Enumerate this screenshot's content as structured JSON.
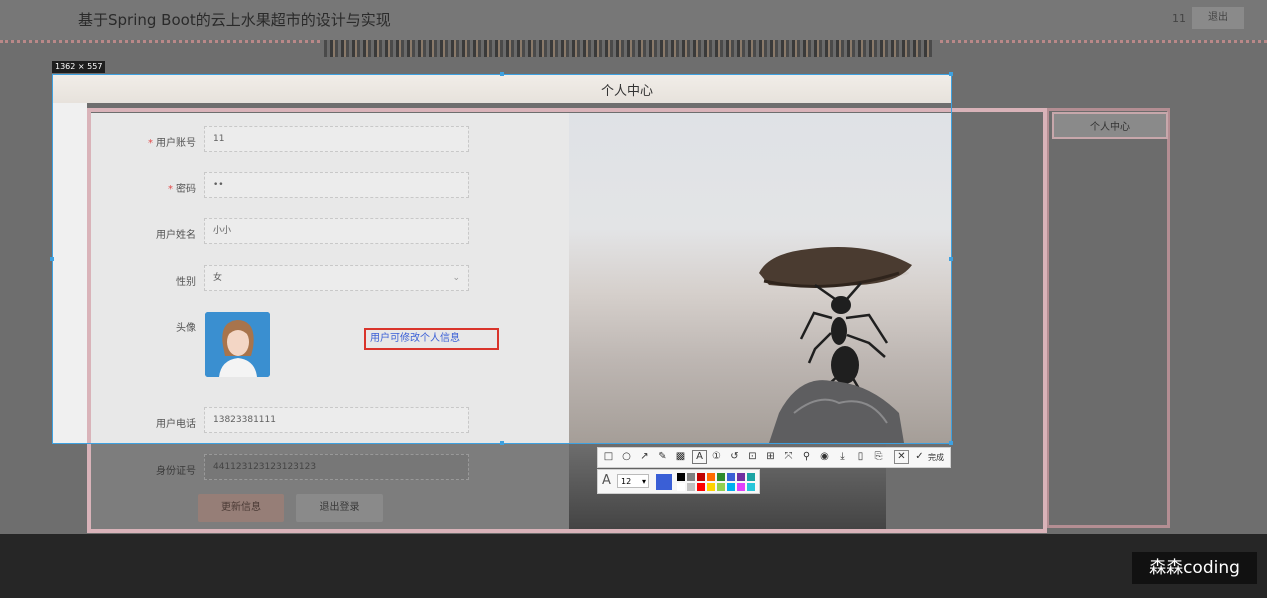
{
  "header": {
    "site_title": "基于Spring Boot的云上水果超市的设计与实现",
    "user": "11",
    "logout_label": "退出"
  },
  "screenshot_tool": {
    "size_label": "1362 × 557",
    "done_label": "完成",
    "font_size_value": "12"
  },
  "page": {
    "title": "个人中心"
  },
  "sidebar": {
    "items": [
      {
        "label": "个人中心"
      }
    ]
  },
  "form": {
    "account": {
      "label": "用户账号",
      "value": "11",
      "required": "*"
    },
    "password": {
      "label": "密码",
      "value": "••",
      "required": "*"
    },
    "name": {
      "label": "用户姓名",
      "value": "小小"
    },
    "gender": {
      "label": "性别",
      "value": "女"
    },
    "avatar": {
      "label": "头像"
    },
    "phone": {
      "label": "用户电话",
      "value": "13823381111"
    },
    "id_card": {
      "label": "身份证号",
      "value": "441123123123123123"
    },
    "update_button": "更新信息",
    "logout_button": "退出登录"
  },
  "annotation_note": "用户可修改个人信息",
  "watermark": "森森coding",
  "colors": {
    "selection": "#3ea1e0",
    "note_border": "#d9342b",
    "note_text": "#3a5fd6",
    "required": "#e24a4a"
  },
  "palette": [
    "#000000",
    "#7f7f7f",
    "#c00000",
    "#ff6a00",
    "#2d8a2d",
    "#3a5fd6",
    "#7030a0",
    "#1aa3a3",
    "#ffffff",
    "#c0c0c0",
    "#ff0000",
    "#ffd200",
    "#92d050",
    "#00b0f0",
    "#e040fb",
    "#26c6da"
  ],
  "toolbar_icons": [
    "rectangle-icon",
    "ellipse-icon",
    "arrow-icon",
    "pencil-icon",
    "mosaic-icon",
    "text-icon",
    "number-icon",
    "undo-icon",
    "ocr-icon",
    "translate-icon",
    "scroll-capture-icon",
    "pin-icon",
    "record-icon",
    "download-icon",
    "save-icon",
    "bookmark-icon",
    "close-icon",
    "check-icon"
  ]
}
